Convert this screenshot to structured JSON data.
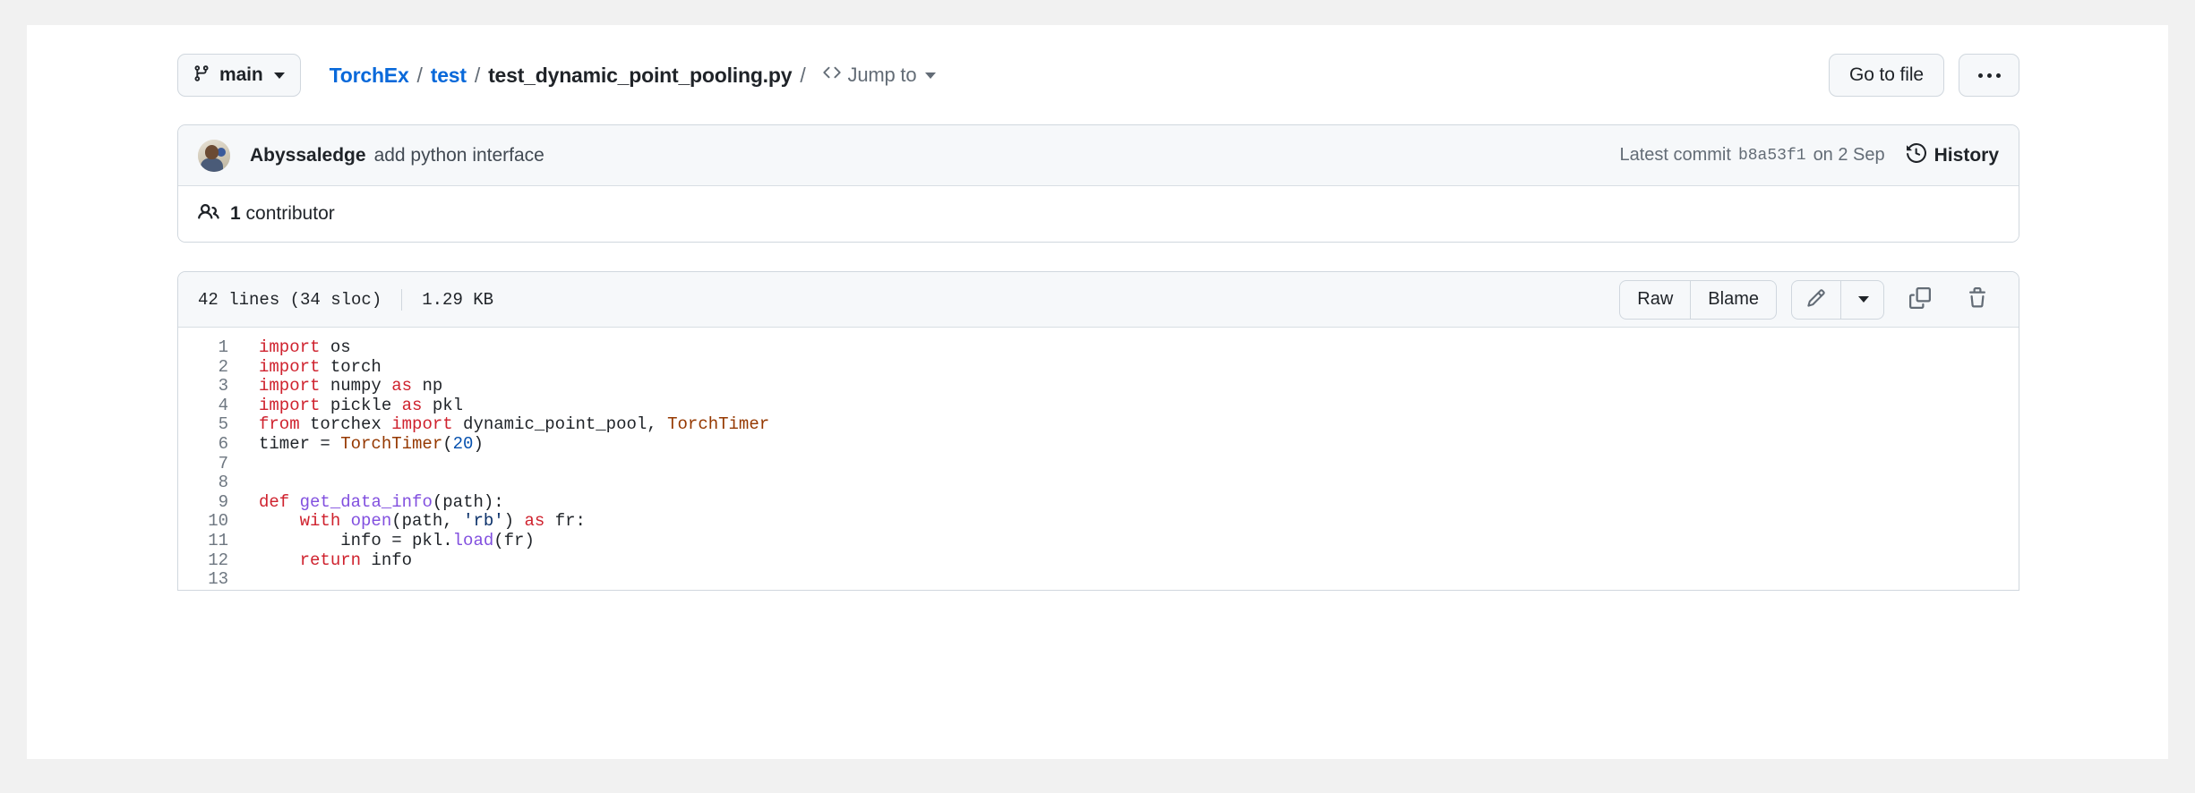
{
  "theme": {
    "canvas": "#f1f1f1",
    "page": "#ffffff",
    "border": "#d0d7de",
    "subtle_bg": "#f6f8fa",
    "accent_link": "#0969da",
    "muted_text": "#636c76",
    "keyword": "#cf222e",
    "function": "#8250df",
    "constant": "#953800",
    "string": "#0a3069",
    "number": "#0550ae"
  },
  "file_header": {
    "branch_button": {
      "label": "main",
      "icon": "git-branch-icon",
      "caret": "chevron-down-icon"
    },
    "breadcrumb": {
      "repo": "TorchEx",
      "folder": "test",
      "filename": "test_dynamic_point_pooling.py",
      "separator": "/"
    },
    "jump_to": {
      "label": "Jump to",
      "icon": "code-brackets-icon",
      "caret": "chevron-down-icon"
    },
    "go_to_file_button": "Go to file",
    "more_button": "..."
  },
  "commit_panel": {
    "author": "Abyssaledge",
    "message": "add python interface",
    "latest_commit_label": "Latest commit",
    "commit_sha": "b8a53f1",
    "commit_date": "on 2 Sep",
    "history_label": "History",
    "history_icon": "history-clock-icon",
    "avatar_icon": "avatar",
    "contributors_icon": "people-icon",
    "contributors_count": "1",
    "contributors_label": "contributor"
  },
  "blob_header": {
    "lines_text": "42 lines (34 sloc)",
    "size_text": "1.29 KB",
    "raw_button": "Raw",
    "blame_button": "Blame",
    "edit_icon": "pencil-icon",
    "edit_dropdown_icon": "chevron-down-icon",
    "copy_icon": "copy-icon",
    "delete_icon": "trash-icon"
  },
  "code": {
    "language": "python",
    "lines": [
      {
        "n": "1",
        "tokens": [
          {
            "t": "import",
            "c": "k"
          },
          {
            "t": " os",
            "c": ""
          }
        ]
      },
      {
        "n": "2",
        "tokens": [
          {
            "t": "import",
            "c": "k"
          },
          {
            "t": " torch",
            "c": ""
          }
        ]
      },
      {
        "n": "3",
        "tokens": [
          {
            "t": "import",
            "c": "k"
          },
          {
            "t": " numpy ",
            "c": ""
          },
          {
            "t": "as",
            "c": "k"
          },
          {
            "t": " np",
            "c": ""
          }
        ]
      },
      {
        "n": "4",
        "tokens": [
          {
            "t": "import",
            "c": "k"
          },
          {
            "t": " pickle ",
            "c": ""
          },
          {
            "t": "as",
            "c": "k"
          },
          {
            "t": " pkl",
            "c": ""
          }
        ]
      },
      {
        "n": "5",
        "tokens": [
          {
            "t": "from",
            "c": "k"
          },
          {
            "t": " torchex ",
            "c": ""
          },
          {
            "t": "import",
            "c": "k"
          },
          {
            "t": " dynamic_point_pool, ",
            "c": ""
          },
          {
            "t": "TorchTimer",
            "c": "cn"
          }
        ]
      },
      {
        "n": "6",
        "tokens": [
          {
            "t": "timer = ",
            "c": ""
          },
          {
            "t": "TorchTimer",
            "c": "cn"
          },
          {
            "t": "(",
            "c": ""
          },
          {
            "t": "20",
            "c": "nm"
          },
          {
            "t": ")",
            "c": ""
          }
        ]
      },
      {
        "n": "7",
        "tokens": []
      },
      {
        "n": "8",
        "tokens": []
      },
      {
        "n": "9",
        "tokens": [
          {
            "t": "def",
            "c": "k"
          },
          {
            "t": " ",
            "c": ""
          },
          {
            "t": "get_data_info",
            "c": "fn"
          },
          {
            "t": "(path):",
            "c": ""
          }
        ]
      },
      {
        "n": "10",
        "tokens": [
          {
            "t": "    ",
            "c": ""
          },
          {
            "t": "with",
            "c": "k"
          },
          {
            "t": " ",
            "c": ""
          },
          {
            "t": "open",
            "c": "fn"
          },
          {
            "t": "(path, ",
            "c": ""
          },
          {
            "t": "'rb'",
            "c": "st"
          },
          {
            "t": ") ",
            "c": ""
          },
          {
            "t": "as",
            "c": "k"
          },
          {
            "t": " fr:",
            "c": ""
          }
        ]
      },
      {
        "n": "11",
        "tokens": [
          {
            "t": "        info = pkl.",
            "c": ""
          },
          {
            "t": "load",
            "c": "fn"
          },
          {
            "t": "(fr)",
            "c": ""
          }
        ]
      },
      {
        "n": "12",
        "tokens": [
          {
            "t": "    ",
            "c": ""
          },
          {
            "t": "return",
            "c": "k"
          },
          {
            "t": " info",
            "c": ""
          }
        ]
      },
      {
        "n": "13",
        "tokens": []
      }
    ]
  }
}
